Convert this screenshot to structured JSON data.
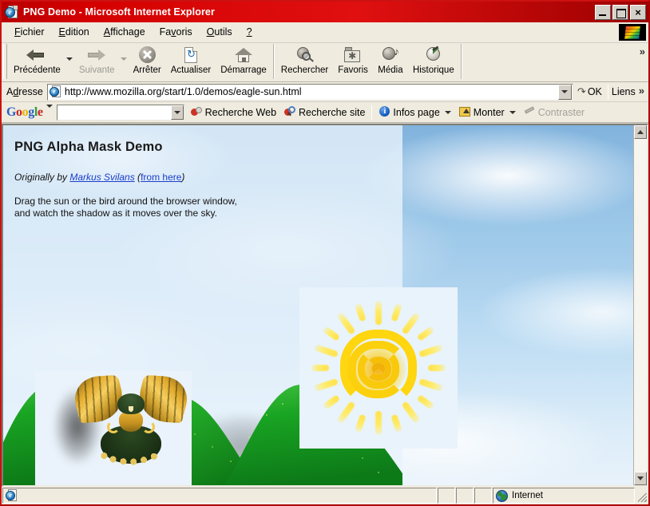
{
  "window": {
    "title": "PNG Demo - Microsoft Internet Explorer",
    "icon": "ie-document-icon",
    "buttons": {
      "minimize": "minimize-button",
      "maximize": "maximize-button",
      "close": "×"
    },
    "titlebar_color": "#d40000"
  },
  "menubar": {
    "items": [
      {
        "label": "Fichier",
        "mnemonic": "F"
      },
      {
        "label": "Edition",
        "mnemonic": "E"
      },
      {
        "label": "Affichage",
        "mnemonic": "A"
      },
      {
        "label": "Favoris",
        "mnemonic": "v"
      },
      {
        "label": "Outils",
        "mnemonic": "O"
      },
      {
        "label": "?",
        "mnemonic": "?"
      }
    ]
  },
  "toolbar": {
    "buttons": [
      {
        "label": "Précédente",
        "icon": "back-arrow-icon",
        "enabled": true,
        "has_dropdown": true
      },
      {
        "label": "Suivante",
        "icon": "forward-arrow-icon",
        "enabled": false,
        "has_dropdown": true
      },
      {
        "label": "Arrêter",
        "icon": "stop-icon",
        "enabled": true
      },
      {
        "label": "Actualiser",
        "icon": "refresh-icon",
        "enabled": true
      },
      {
        "label": "Démarrage",
        "icon": "home-icon",
        "enabled": true
      },
      {
        "label": "Rechercher",
        "icon": "search-globe-icon",
        "enabled": true
      },
      {
        "label": "Favoris",
        "icon": "favorites-folder-icon",
        "enabled": true
      },
      {
        "label": "Média",
        "icon": "media-globe-icon",
        "enabled": true
      },
      {
        "label": "Historique",
        "icon": "history-clock-icon",
        "enabled": true
      }
    ],
    "overflow_chevron": "»"
  },
  "address_bar": {
    "label": "Adresse",
    "mnemonic": "d",
    "url": "http://www.mozilla.org/start/1.0/demos/eagle-sun.html",
    "placeholder": "",
    "favicon": "ie-page-icon",
    "dropdown_icon": "chevron-down-icon",
    "go_label": "OK",
    "go_icon": "go-arrow-icon",
    "links_label": "Liens",
    "overflow_chevron": "»"
  },
  "google_bar": {
    "logo": {
      "text": "Google",
      "letters": [
        "G",
        "o",
        "o",
        "g",
        "l",
        "e"
      ]
    },
    "search_value": "",
    "search_placeholder": "",
    "buttons": [
      {
        "label": "Recherche Web",
        "icon": "google-web-search-icon",
        "enabled": true,
        "has_dropdown": false
      },
      {
        "label": "Recherche site",
        "icon": "google-site-search-icon",
        "enabled": true,
        "has_dropdown": false
      },
      {
        "label": "Infos page",
        "icon": "page-info-icon",
        "enabled": true,
        "has_dropdown": true
      },
      {
        "label": "Monter",
        "icon": "up-folder-icon",
        "enabled": true,
        "has_dropdown": true
      },
      {
        "label": "Contraster",
        "icon": "highlight-pen-icon",
        "enabled": false,
        "has_dropdown": false
      }
    ]
  },
  "page": {
    "title": "PNG Alpha Mask Demo",
    "credit": {
      "prefix": "Originally by ",
      "author": "Markus Svilans",
      "paren_open": " (",
      "source_link": "from here",
      "paren_close": ")"
    },
    "description": "Drag the sun or the bird around the browser window,\nand watch the shadow as it moves over the sky.",
    "images": [
      {
        "name": "sun-image",
        "alt": "sun",
        "draggable": true
      },
      {
        "name": "eagle-image",
        "alt": "eagle",
        "draggable": true
      },
      {
        "name": "hills-image",
        "alt": "green hills",
        "draggable": false
      }
    ],
    "colors": {
      "sky_top": "#7fb2dd",
      "sky_bottom": "#e8f2fb",
      "panel": "#e8f2fb",
      "sun": "#ffd60f",
      "hill": "#22a82e",
      "link": "#1a3ecc"
    }
  },
  "scrollbar": {
    "up_icon": "scroll-up-arrow-icon",
    "down_icon": "scroll-down-arrow-icon"
  },
  "status_bar": {
    "text": "",
    "icon": "ie-page-icon",
    "zone_label": "Internet",
    "zone_icon": "internet-zone-globe-icon",
    "resize_grip": "resize-grip"
  }
}
